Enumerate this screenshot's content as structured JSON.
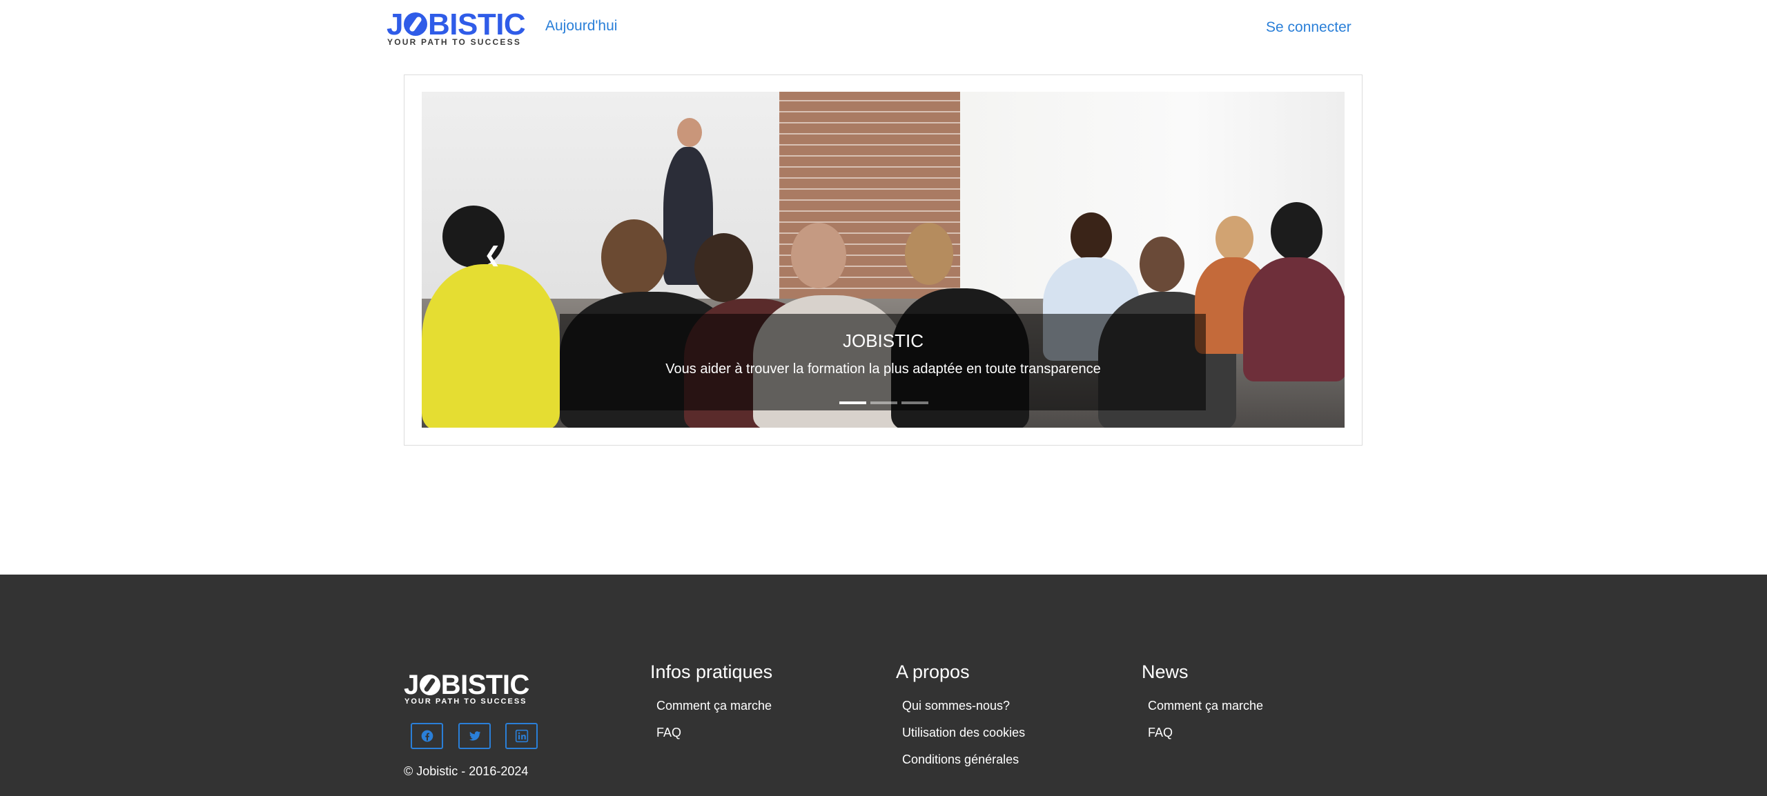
{
  "header": {
    "logo_text_start": "J",
    "logo_text_end": "BISTIC",
    "logo_tagline": "YOUR PATH TO SUCCESS",
    "nav_today": "Aujourd'hui",
    "nav_login": "Se connecter"
  },
  "carousel": {
    "slides_count": 3,
    "active_slide": 1,
    "caption_title": "JOBISTIC",
    "caption_text": "Vous aider à trouver la formation la plus adaptée en toute transparence",
    "prev_icon": "chevron-left-icon"
  },
  "footer": {
    "logo_text_start": "J",
    "logo_text_end": "BISTIC",
    "logo_tagline": "YOUR PATH TO SUCCESS",
    "social": [
      {
        "name": "facebook-icon"
      },
      {
        "name": "twitter-icon"
      },
      {
        "name": "linkedin-icon"
      }
    ],
    "copyright": "© Jobistic - 2016-2024",
    "columns": [
      {
        "title": "Infos pratiques",
        "links": [
          "Comment ça marche",
          "FAQ"
        ]
      },
      {
        "title": "A propos",
        "links": [
          "Qui sommes-nous?",
          "Utilisation des cookies",
          "Conditions générales"
        ]
      },
      {
        "title": "News",
        "links": [
          "Comment ça marche",
          "FAQ"
        ]
      }
    ]
  },
  "colors": {
    "brand_blue": "#2f5ce8",
    "link_blue": "#2a7fd8",
    "footer_bg": "#333333"
  }
}
